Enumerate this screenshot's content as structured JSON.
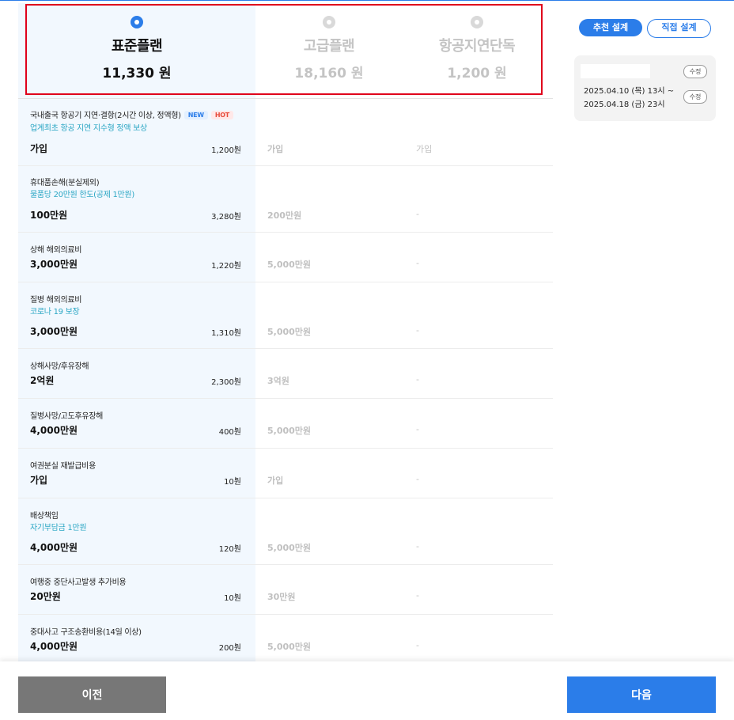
{
  "plans": [
    {
      "name": "표준플랜",
      "price": "11,330 원"
    },
    {
      "name": "고급플랜",
      "price": "18,160 원"
    },
    {
      "name": "항공지연단독",
      "price": "1,200 원"
    }
  ],
  "badges": {
    "new": "NEW",
    "hot": "HOT"
  },
  "chevron": "›",
  "rows": [
    {
      "label": "국내출국 항공기 지연·결항(2시간 이상, 정액형)",
      "sub": "업계최초 항공 지연 지수형 정액 보상",
      "value": "가입",
      "price": "1,200원",
      "c2": "가입",
      "c3": "가입"
    },
    {
      "label": "휴대품손해(분실제외)",
      "sub": "물품당 20만원 한도(공제 1만원)",
      "value": "100만원",
      "price": "3,280원",
      "c2": "200만원",
      "c3": "-"
    },
    {
      "label": "상해 해외의료비",
      "sub": "",
      "value": "3,000만원",
      "price": "1,220원",
      "c2": "5,000만원",
      "c3": "-"
    },
    {
      "label": "질병 해외의료비",
      "sub": "코로나 19 보장",
      "value": "3,000만원",
      "price": "1,310원",
      "c2": "5,000만원",
      "c3": "-"
    },
    {
      "label": "상해사망/후유장해",
      "sub": "",
      "value": "2억원",
      "price": "2,300원",
      "c2": "3억원",
      "c3": "-"
    },
    {
      "label": "질병사망/고도후유장해",
      "sub": "",
      "value": "4,000만원",
      "price": "400원",
      "c2": "5,000만원",
      "c3": "-"
    },
    {
      "label": "여권분실 재발급비용",
      "sub": "",
      "value": "가입",
      "price": "10원",
      "c2": "가입",
      "c3": "-"
    },
    {
      "label": "배상책임",
      "sub": "자기부담금 1만원",
      "value": "4,000만원",
      "price": "120원",
      "c2": "5,000만원",
      "c3": "-"
    },
    {
      "label": "여행중 중단사고발생 추가비용",
      "sub": "",
      "value": "20만원",
      "price": "10원",
      "c2": "30만원",
      "c3": "-"
    },
    {
      "label": "중대사고 구조송환비용(14일 이상)",
      "sub": "",
      "value": "4,000만원",
      "price": "200원",
      "c2": "5,000만원",
      "c3": "-"
    }
  ],
  "side": {
    "tab_recommend": "추천 설계",
    "tab_direct": "직접 설계",
    "edit_label": "수정",
    "date_start": "2025.04.10 (목) 13시 ~",
    "date_end": "2025.04.18 (금) 23시"
  },
  "buttons": {
    "prev": "이전",
    "next": "다음"
  },
  "colors": {
    "accent": "#2b7de9",
    "highlight_border": "#e0001b",
    "sub_text": "#2aa6c4",
    "prev_button": "#777777"
  }
}
